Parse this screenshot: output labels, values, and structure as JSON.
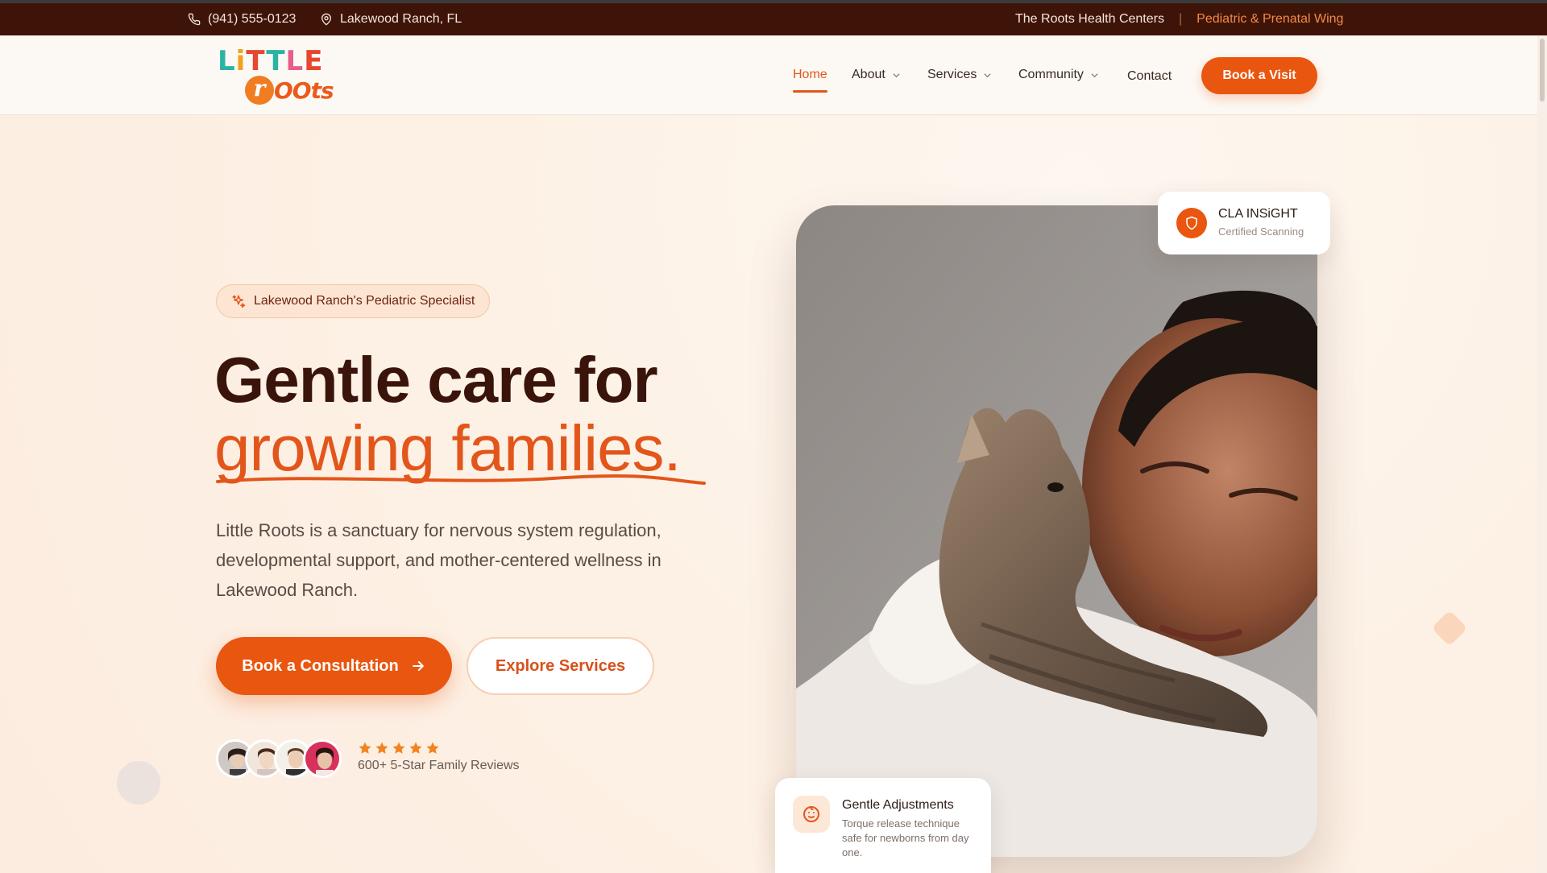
{
  "topbar": {
    "phone": "(941) 555-0123",
    "location": "Lakewood Ranch, FL",
    "org": "The Roots Health Centers",
    "separator": "|",
    "wing": "Pediatric & Prenatal Wing"
  },
  "logo": {
    "line1": "LiTTLE",
    "r": "r",
    "line2": "OOts"
  },
  "nav": {
    "items": [
      {
        "label": "Home",
        "active": true,
        "has_dropdown": false
      },
      {
        "label": "About",
        "active": false,
        "has_dropdown": true
      },
      {
        "label": "Services",
        "active": false,
        "has_dropdown": true
      },
      {
        "label": "Community",
        "active": false,
        "has_dropdown": true
      },
      {
        "label": "Contact",
        "active": false,
        "has_dropdown": false
      }
    ],
    "cta": "Book a Visit"
  },
  "hero": {
    "badge": "Lakewood Ranch's Pediatric Specialist",
    "headline_line1": "Gentle care for",
    "headline_line2": "growing families.",
    "lede": "Little Roots is a sanctuary for nervous system regulation, developmental support, and mother-centered wellness in Lakewood Ranch.",
    "primary_cta": "Book a Consultation",
    "secondary_cta": "Explore Services",
    "rating_stars": 5,
    "reviews_text": "600+ 5-Star Family Reviews"
  },
  "cards": {
    "cla": {
      "title": "CLA INSiGHT",
      "subtitle": "Certified Scanning"
    },
    "gentle": {
      "title": "Gentle Adjustments",
      "description": "Torque release technique safe for newborns from day one."
    }
  },
  "colors": {
    "brand": "#e9560f",
    "dark": "#3f1408",
    "heading": "#3a140a",
    "background": "#fdf1e6"
  }
}
